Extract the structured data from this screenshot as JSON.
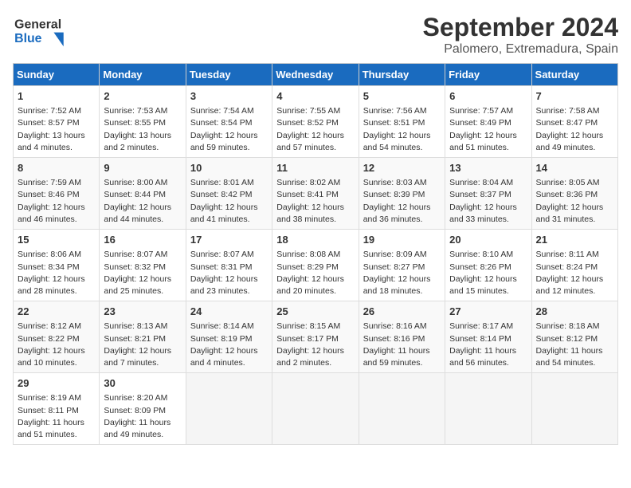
{
  "header": {
    "logo_line1": "General",
    "logo_line2": "Blue",
    "title": "September 2024",
    "subtitle": "Palomero, Extremadura, Spain"
  },
  "weekdays": [
    "Sunday",
    "Monday",
    "Tuesday",
    "Wednesday",
    "Thursday",
    "Friday",
    "Saturday"
  ],
  "weeks": [
    [
      {
        "day": "1",
        "sunrise": "Sunrise: 7:52 AM",
        "sunset": "Sunset: 8:57 PM",
        "daylight": "Daylight: 13 hours and 4 minutes."
      },
      {
        "day": "2",
        "sunrise": "Sunrise: 7:53 AM",
        "sunset": "Sunset: 8:55 PM",
        "daylight": "Daylight: 13 hours and 2 minutes."
      },
      {
        "day": "3",
        "sunrise": "Sunrise: 7:54 AM",
        "sunset": "Sunset: 8:54 PM",
        "daylight": "Daylight: 12 hours and 59 minutes."
      },
      {
        "day": "4",
        "sunrise": "Sunrise: 7:55 AM",
        "sunset": "Sunset: 8:52 PM",
        "daylight": "Daylight: 12 hours and 57 minutes."
      },
      {
        "day": "5",
        "sunrise": "Sunrise: 7:56 AM",
        "sunset": "Sunset: 8:51 PM",
        "daylight": "Daylight: 12 hours and 54 minutes."
      },
      {
        "day": "6",
        "sunrise": "Sunrise: 7:57 AM",
        "sunset": "Sunset: 8:49 PM",
        "daylight": "Daylight: 12 hours and 51 minutes."
      },
      {
        "day": "7",
        "sunrise": "Sunrise: 7:58 AM",
        "sunset": "Sunset: 8:47 PM",
        "daylight": "Daylight: 12 hours and 49 minutes."
      }
    ],
    [
      {
        "day": "8",
        "sunrise": "Sunrise: 7:59 AM",
        "sunset": "Sunset: 8:46 PM",
        "daylight": "Daylight: 12 hours and 46 minutes."
      },
      {
        "day": "9",
        "sunrise": "Sunrise: 8:00 AM",
        "sunset": "Sunset: 8:44 PM",
        "daylight": "Daylight: 12 hours and 44 minutes."
      },
      {
        "day": "10",
        "sunrise": "Sunrise: 8:01 AM",
        "sunset": "Sunset: 8:42 PM",
        "daylight": "Daylight: 12 hours and 41 minutes."
      },
      {
        "day": "11",
        "sunrise": "Sunrise: 8:02 AM",
        "sunset": "Sunset: 8:41 PM",
        "daylight": "Daylight: 12 hours and 38 minutes."
      },
      {
        "day": "12",
        "sunrise": "Sunrise: 8:03 AM",
        "sunset": "Sunset: 8:39 PM",
        "daylight": "Daylight: 12 hours and 36 minutes."
      },
      {
        "day": "13",
        "sunrise": "Sunrise: 8:04 AM",
        "sunset": "Sunset: 8:37 PM",
        "daylight": "Daylight: 12 hours and 33 minutes."
      },
      {
        "day": "14",
        "sunrise": "Sunrise: 8:05 AM",
        "sunset": "Sunset: 8:36 PM",
        "daylight": "Daylight: 12 hours and 31 minutes."
      }
    ],
    [
      {
        "day": "15",
        "sunrise": "Sunrise: 8:06 AM",
        "sunset": "Sunset: 8:34 PM",
        "daylight": "Daylight: 12 hours and 28 minutes."
      },
      {
        "day": "16",
        "sunrise": "Sunrise: 8:07 AM",
        "sunset": "Sunset: 8:32 PM",
        "daylight": "Daylight: 12 hours and 25 minutes."
      },
      {
        "day": "17",
        "sunrise": "Sunrise: 8:07 AM",
        "sunset": "Sunset: 8:31 PM",
        "daylight": "Daylight: 12 hours and 23 minutes."
      },
      {
        "day": "18",
        "sunrise": "Sunrise: 8:08 AM",
        "sunset": "Sunset: 8:29 PM",
        "daylight": "Daylight: 12 hours and 20 minutes."
      },
      {
        "day": "19",
        "sunrise": "Sunrise: 8:09 AM",
        "sunset": "Sunset: 8:27 PM",
        "daylight": "Daylight: 12 hours and 18 minutes."
      },
      {
        "day": "20",
        "sunrise": "Sunrise: 8:10 AM",
        "sunset": "Sunset: 8:26 PM",
        "daylight": "Daylight: 12 hours and 15 minutes."
      },
      {
        "day": "21",
        "sunrise": "Sunrise: 8:11 AM",
        "sunset": "Sunset: 8:24 PM",
        "daylight": "Daylight: 12 hours and 12 minutes."
      }
    ],
    [
      {
        "day": "22",
        "sunrise": "Sunrise: 8:12 AM",
        "sunset": "Sunset: 8:22 PM",
        "daylight": "Daylight: 12 hours and 10 minutes."
      },
      {
        "day": "23",
        "sunrise": "Sunrise: 8:13 AM",
        "sunset": "Sunset: 8:21 PM",
        "daylight": "Daylight: 12 hours and 7 minutes."
      },
      {
        "day": "24",
        "sunrise": "Sunrise: 8:14 AM",
        "sunset": "Sunset: 8:19 PM",
        "daylight": "Daylight: 12 hours and 4 minutes."
      },
      {
        "day": "25",
        "sunrise": "Sunrise: 8:15 AM",
        "sunset": "Sunset: 8:17 PM",
        "daylight": "Daylight: 12 hours and 2 minutes."
      },
      {
        "day": "26",
        "sunrise": "Sunrise: 8:16 AM",
        "sunset": "Sunset: 8:16 PM",
        "daylight": "Daylight: 11 hours and 59 minutes."
      },
      {
        "day": "27",
        "sunrise": "Sunrise: 8:17 AM",
        "sunset": "Sunset: 8:14 PM",
        "daylight": "Daylight: 11 hours and 56 minutes."
      },
      {
        "day": "28",
        "sunrise": "Sunrise: 8:18 AM",
        "sunset": "Sunset: 8:12 PM",
        "daylight": "Daylight: 11 hours and 54 minutes."
      }
    ],
    [
      {
        "day": "29",
        "sunrise": "Sunrise: 8:19 AM",
        "sunset": "Sunset: 8:11 PM",
        "daylight": "Daylight: 11 hours and 51 minutes."
      },
      {
        "day": "30",
        "sunrise": "Sunrise: 8:20 AM",
        "sunset": "Sunset: 8:09 PM",
        "daylight": "Daylight: 11 hours and 49 minutes."
      },
      null,
      null,
      null,
      null,
      null
    ]
  ]
}
